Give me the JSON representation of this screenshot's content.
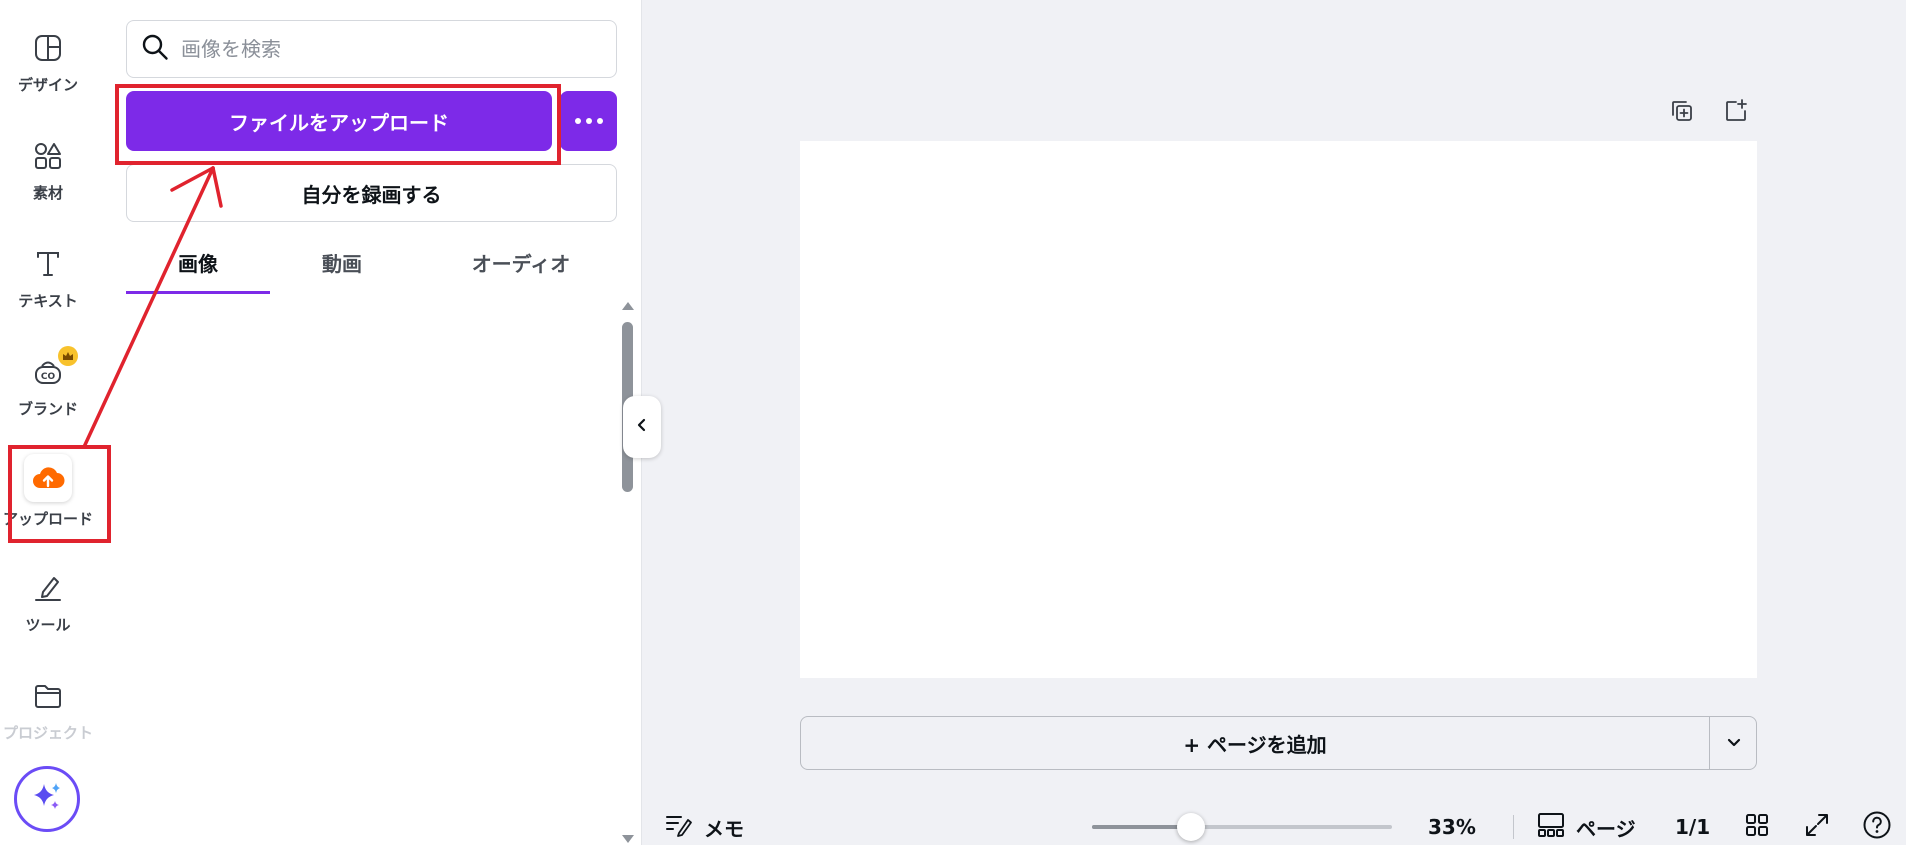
{
  "rail": {
    "items": [
      {
        "label": "デザイン",
        "icon": "layout-icon"
      },
      {
        "label": "素材",
        "icon": "shapes-icon"
      },
      {
        "label": "テキスト",
        "icon": "text-icon"
      },
      {
        "label": "ブランド",
        "icon": "brand-icon"
      },
      {
        "label": "アップロード",
        "icon": "cloud-upload-icon"
      },
      {
        "label": "ツール",
        "icon": "pen-tool-icon"
      },
      {
        "label": "プロジェクト",
        "icon": "folder-icon"
      }
    ],
    "active": "アップロード",
    "brand_badge_icon": "crown-icon",
    "magic_button_icon": "sparkle-icon"
  },
  "panel": {
    "search_placeholder": "画像を検索",
    "upload_button": "ファイルをアップロード",
    "more_button_icon": "more-dots-icon",
    "record_button": "自分を録画する",
    "tabs": [
      {
        "label": "画像",
        "active": true
      },
      {
        "label": "動画",
        "active": false
      },
      {
        "label": "オーディオ",
        "active": false
      }
    ]
  },
  "canvas": {
    "add_page_label": "+ ページを追加"
  },
  "bottom_bar": {
    "notes_label": "メモ",
    "zoom_value": "33%",
    "zoom_fraction": 0.33,
    "pages_label": "ページ",
    "page_count": "1/1"
  },
  "colors": {
    "accent": "#7d2ae8",
    "annotation": "#e0232e",
    "upload_icon": "#ff6a00"
  }
}
